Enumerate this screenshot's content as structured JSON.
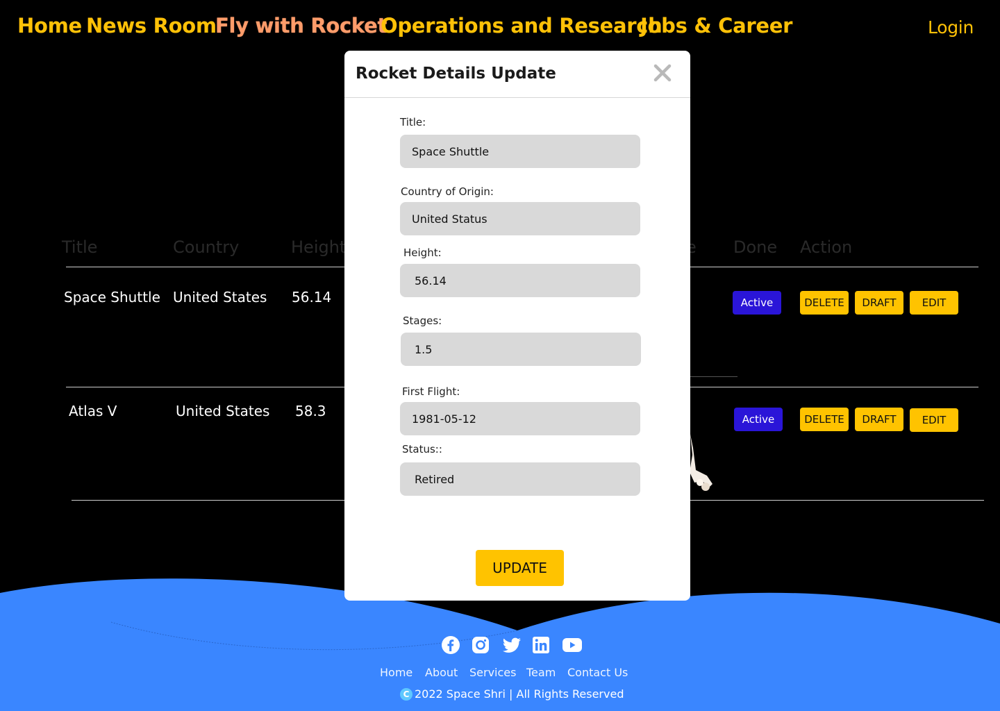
{
  "nav": {
    "items": [
      "Home",
      "News Room",
      "Fly with Rocket",
      "Operations and Research",
      "Jobs & Career"
    ],
    "active": "Fly with Rocket",
    "login": "Login"
  },
  "table": {
    "headers": [
      "Title",
      "Country",
      "Height",
      "e",
      "Done",
      "Action"
    ],
    "rows": [
      {
        "title": "Space Shuttle",
        "country": "United States",
        "height": "56.14",
        "status": "Active"
      },
      {
        "title": "Atlas V",
        "country": "United States",
        "height": "58.3",
        "status": "Active"
      }
    ],
    "actions": {
      "delete": "DELETE",
      "draft": "DRAFT",
      "edit": "EDIT"
    }
  },
  "modal": {
    "title": "Rocket Details Update",
    "fields": [
      {
        "label": "Title:",
        "value": "Space Shuttle"
      },
      {
        "label": "Country of Origin:",
        "value": "United Status"
      },
      {
        "label": "Height:",
        "value": "56.14"
      },
      {
        "label": "Stages:",
        "value": "1.5"
      },
      {
        "label": "First Flight:",
        "value": "1981-05-12"
      },
      {
        "label": "Status::",
        "value": "Retired"
      }
    ],
    "submit": "UPDATE"
  },
  "footer": {
    "social_icons": [
      "facebook-icon",
      "instagram-icon",
      "twitter-icon",
      "linkedin-icon",
      "youtube-icon"
    ],
    "links": [
      "Home",
      "About",
      "Services",
      "Team",
      "Contact Us"
    ],
    "copyright": "2022 Space Shri | All Rights Reserved"
  },
  "colors": {
    "accent": "#ffc107",
    "active_nav": "#ff9c6a",
    "status_button": "#2a15d8",
    "footer_bg": "#3a86ff"
  }
}
